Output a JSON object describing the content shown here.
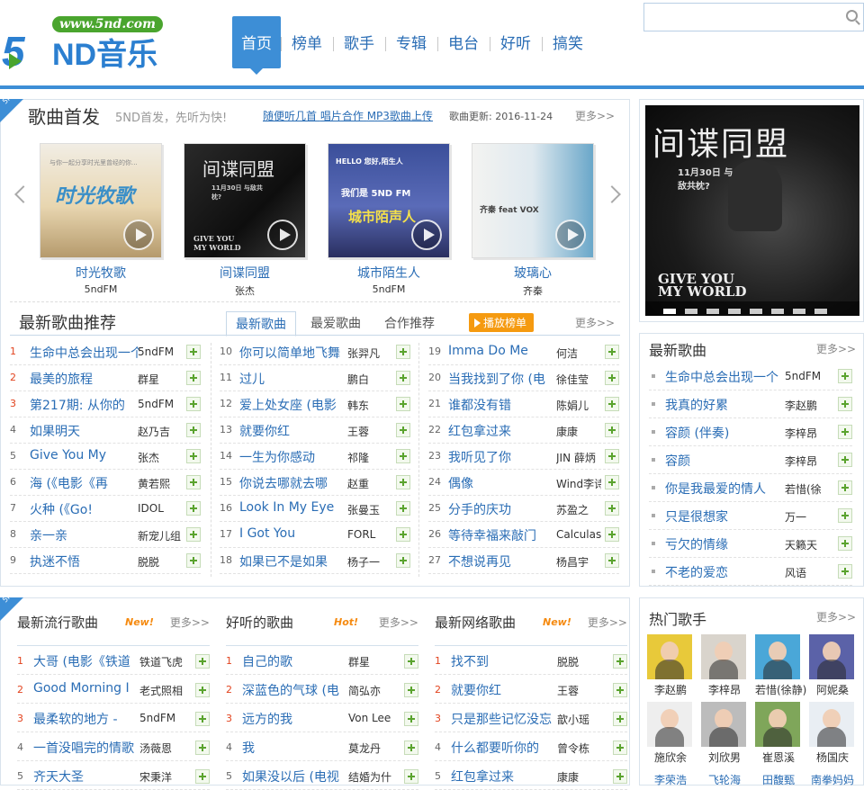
{
  "logo": {
    "url": "www.5nd.com",
    "brand": "5ND",
    "name": "音乐"
  },
  "nav": [
    "首页",
    "榜单",
    "歌手",
    "专辑",
    "电台",
    "好听",
    "搞笑"
  ],
  "search": {
    "placeholder": ""
  },
  "first_release": {
    "title": "歌曲首发",
    "slogan": "5ND首发，先听为快!",
    "links": [
      "随便听几首",
      "唱片合作",
      "MP3歌曲上传"
    ],
    "update_label": "歌曲更新: 2016-11-24",
    "more": "更多>>",
    "albums": [
      {
        "title": "时光牧歌",
        "artist": "5ndFM",
        "cover_text": "时光牧歌",
        "cover_top": "与你一起分享时光里曾经的你..."
      },
      {
        "title": "间谍同盟",
        "artist": "张杰",
        "cover_text": "间谍同盟",
        "cover_sub": "11月30日 与敌共枕?",
        "cover_bottom": "GIVE YOU MY WORLD"
      },
      {
        "title": "城市陌生人",
        "artist": "5ndFM",
        "cover_text": "城市陌声人",
        "cover_top": "HELLO 您好,陌生人",
        "cover_sub": "我们是 5ND FM"
      },
      {
        "title": "玻璃心",
        "artist": "齐秦",
        "cover_text": "齐秦 feat VOX"
      }
    ]
  },
  "recommend": {
    "title": "最新歌曲推荐",
    "tabs": [
      "最新歌曲",
      "最爱歌曲",
      "合作推荐"
    ],
    "play_label": "播放榜单",
    "more": "更多>>",
    "songs": [
      {
        "n": "1",
        "name": "生命中总会出现一个",
        "artist": "5ndFM"
      },
      {
        "n": "2",
        "name": "最美的旅程",
        "artist": "群星"
      },
      {
        "n": "3",
        "name": "第217期: 从你的",
        "artist": "5ndFM"
      },
      {
        "n": "4",
        "name": "如果明天",
        "artist": "赵乃吉"
      },
      {
        "n": "5",
        "name": "Give You My",
        "artist": "张杰"
      },
      {
        "n": "6",
        "name": "海 (《电影《再",
        "artist": "黄若熙"
      },
      {
        "n": "7",
        "name": "火种 (《Go!",
        "artist": "IDOL"
      },
      {
        "n": "8",
        "name": "亲一亲",
        "artist": "新宠儿组"
      },
      {
        "n": "9",
        "name": "执迷不悟",
        "artist": "脱脱"
      },
      {
        "n": "10",
        "name": "你可以简单地飞舞",
        "artist": "张羿凡"
      },
      {
        "n": "11",
        "name": "过儿",
        "artist": "鹏白"
      },
      {
        "n": "12",
        "name": "爱上处女座 (电影",
        "artist": "韩东"
      },
      {
        "n": "13",
        "name": "就要你红",
        "artist": "王蓉"
      },
      {
        "n": "14",
        "name": "一生为你感动",
        "artist": "祁隆"
      },
      {
        "n": "15",
        "name": "你说去哪就去哪",
        "artist": "赵重"
      },
      {
        "n": "16",
        "name": "Look In My Eye",
        "artist": "张曼玉"
      },
      {
        "n": "17",
        "name": "I Got You",
        "artist": "FORL"
      },
      {
        "n": "18",
        "name": "如果已不是如果",
        "artist": "杨子一"
      },
      {
        "n": "19",
        "name": "Imma Do Me",
        "artist": "何洁"
      },
      {
        "n": "20",
        "name": "当我找到了你 (电",
        "artist": "徐佳莹"
      },
      {
        "n": "21",
        "name": "谁都没有错",
        "artist": "陈娟儿"
      },
      {
        "n": "22",
        "name": "红包拿过来",
        "artist": "康康"
      },
      {
        "n": "23",
        "name": "我听见了你",
        "artist": "JIN 薛炳"
      },
      {
        "n": "24",
        "name": "偶像",
        "artist": "Wind李诗"
      },
      {
        "n": "25",
        "name": "分手的庆功",
        "artist": "苏盈之"
      },
      {
        "n": "26",
        "name": "等待幸福来敲门",
        "artist": "Calculas"
      },
      {
        "n": "27",
        "name": "不想说再见",
        "artist": "杨昌宇"
      }
    ]
  },
  "banner": {
    "title": "间谍同盟",
    "sub": "11月30日 与敌共枕?",
    "bottom": "GIVE YOU MY WORLD"
  },
  "newest": {
    "title": "最新歌曲",
    "more": "更多>>",
    "songs": [
      {
        "name": "生命中总会出现一个",
        "artist": "5ndFM"
      },
      {
        "name": "我真的好累",
        "artist": "李赵鹏"
      },
      {
        "name": "容颜 (伴奏)",
        "artist": "李梓昂"
      },
      {
        "name": "容颜",
        "artist": "李梓昂"
      },
      {
        "name": "你是我最爱的情人",
        "artist": "若惜(徐"
      },
      {
        "name": "只是很想家",
        "artist": "万一"
      },
      {
        "name": "亏欠的情缘",
        "artist": "天籁天"
      },
      {
        "name": "不老的爱恋",
        "artist": "风语"
      }
    ]
  },
  "popular": [
    {
      "title": "最新流行歌曲",
      "badge": "New!",
      "more": "更多>>",
      "songs": [
        {
          "n": "1",
          "name": "大哥 (电影《铁道",
          "artist": "铁道飞虎"
        },
        {
          "n": "2",
          "name": "Good Morning I",
          "artist": "老式照相"
        },
        {
          "n": "3",
          "name": "最柔软的地方 -",
          "artist": "5ndFM"
        },
        {
          "n": "4",
          "name": "一首没唱完的情歌",
          "artist": "汤薇恩"
        },
        {
          "n": "5",
          "name": "齐天大圣",
          "artist": "宋秉洋"
        }
      ]
    },
    {
      "title": "好听的歌曲",
      "badge": "Hot!",
      "more": "更多>>",
      "songs": [
        {
          "n": "1",
          "name": "自己的歌",
          "artist": "群星"
        },
        {
          "n": "2",
          "name": "深蓝色的气球 (电",
          "artist": "简弘亦"
        },
        {
          "n": "3",
          "name": "远方的我",
          "artist": "Von Lee"
        },
        {
          "n": "4",
          "name": "我",
          "artist": "莫龙丹"
        },
        {
          "n": "5",
          "name": "如果没以后 (电视",
          "artist": "结婚为什"
        }
      ]
    },
    {
      "title": "最新网络歌曲",
      "badge": "New!",
      "more": "更多>>",
      "songs": [
        {
          "n": "1",
          "name": "找不到",
          "artist": "脱脱"
        },
        {
          "n": "2",
          "name": "就要你红",
          "artist": "王蓉"
        },
        {
          "n": "3",
          "name": "只是那些记忆没忘",
          "artist": "歆小瑶"
        },
        {
          "n": "4",
          "name": "什么都要听你的",
          "artist": "曾令栋"
        },
        {
          "n": "5",
          "name": "红包拿过来",
          "artist": "康康"
        }
      ]
    }
  ],
  "singers": {
    "title": "热门歌手",
    "more": "更多>>",
    "list": [
      {
        "name": "李赵鹏",
        "bg": "#e8c93a"
      },
      {
        "name": "李梓昂",
        "bg": "#d9d4cc"
      },
      {
        "name": "若惜(徐静)",
        "bg": "#4aa7d8"
      },
      {
        "name": "阿妮桑",
        "bg": "#5b62a8"
      },
      {
        "name": "施欣余",
        "bg": "#eeeeee"
      },
      {
        "name": "刘欣男",
        "bg": "#bcbcbc"
      },
      {
        "name": "崔恩溪",
        "bg": "#7fa65a"
      },
      {
        "name": "杨国庆",
        "bg": "#e9eef3"
      },
      {
        "name": "李荣浩",
        "bg": ""
      },
      {
        "name": "飞轮海",
        "bg": ""
      },
      {
        "name": "田馥甄",
        "bg": ""
      },
      {
        "name": "南拳妈妈",
        "bg": ""
      }
    ]
  }
}
